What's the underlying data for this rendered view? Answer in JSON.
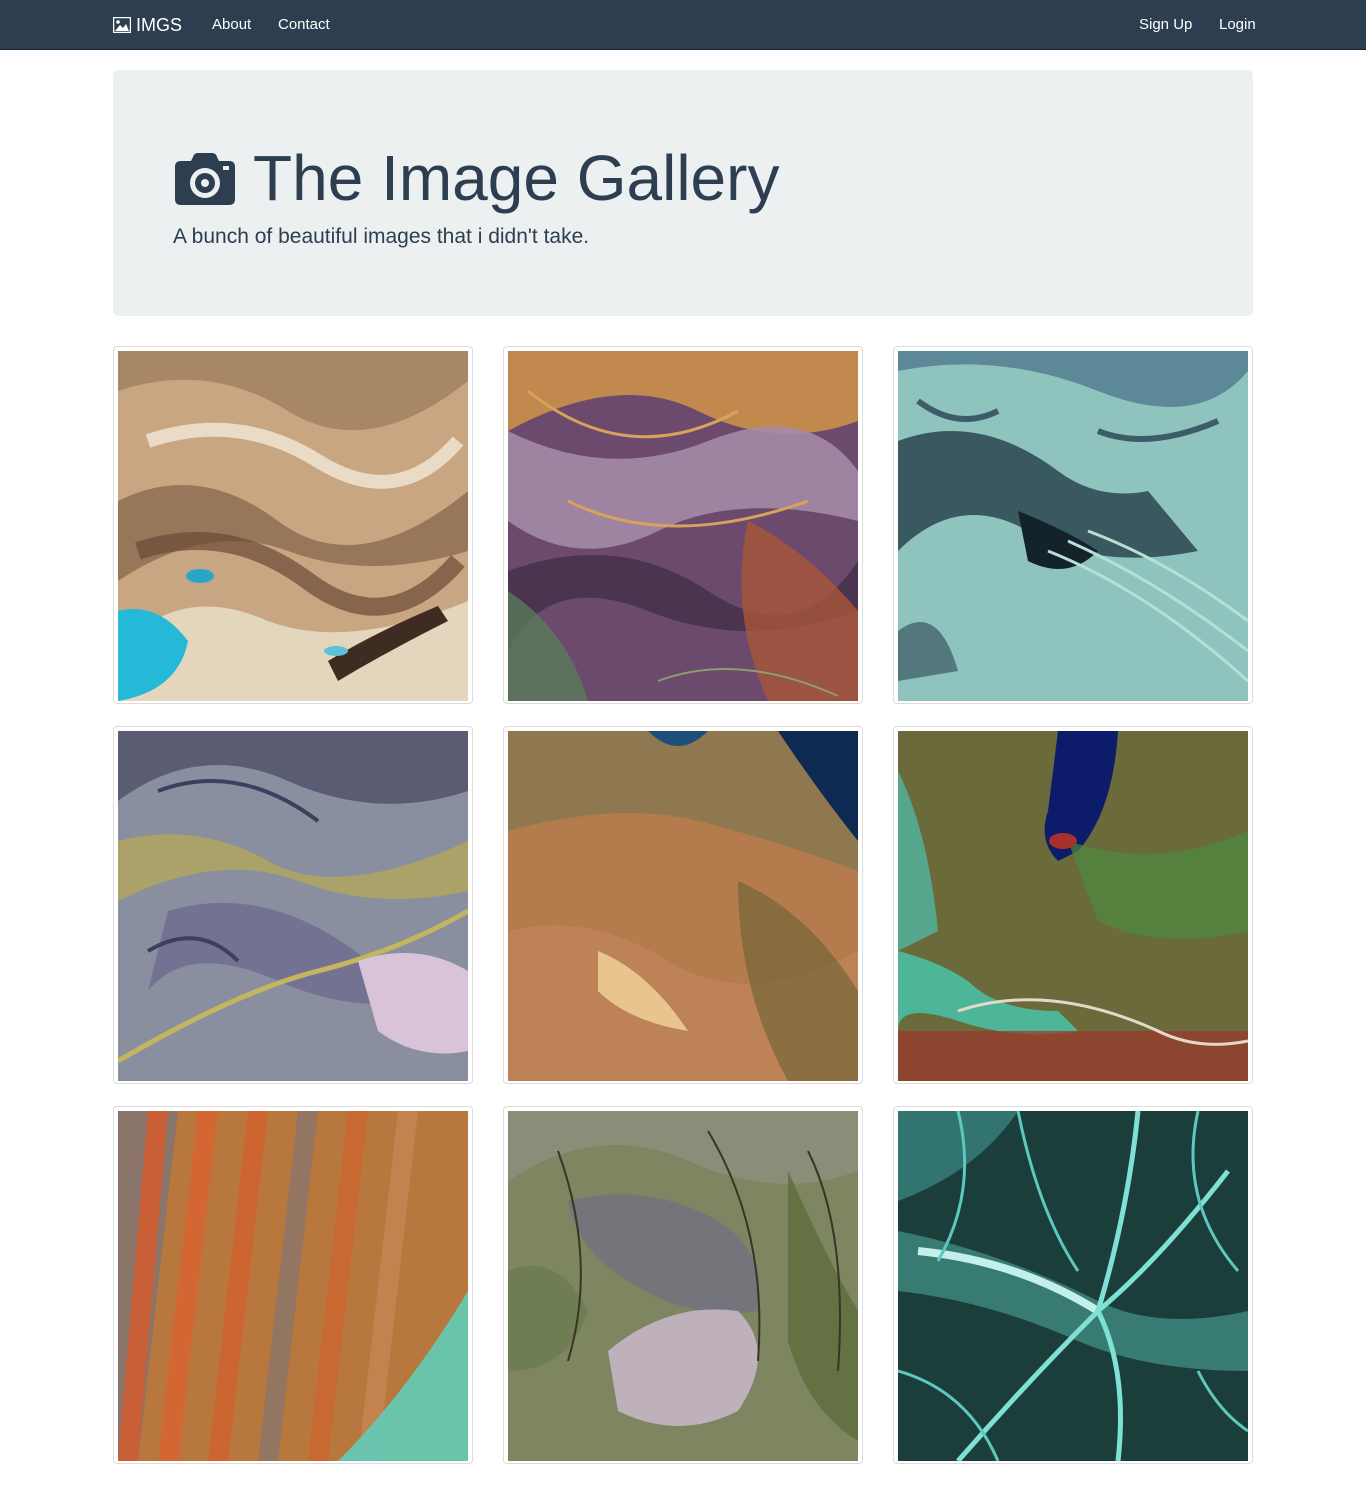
{
  "navbar": {
    "brand": "IMGS",
    "links": [
      "About",
      "Contact"
    ],
    "right_links": [
      "Sign Up",
      "Login"
    ]
  },
  "jumbotron": {
    "title": "The Image Gallery",
    "subtitle": "A bunch of beautiful images that i didn't take."
  },
  "colors": {
    "navbar": "#2c3e50",
    "jumbotron": "#ecf0f1",
    "text": "#2c3e50"
  }
}
